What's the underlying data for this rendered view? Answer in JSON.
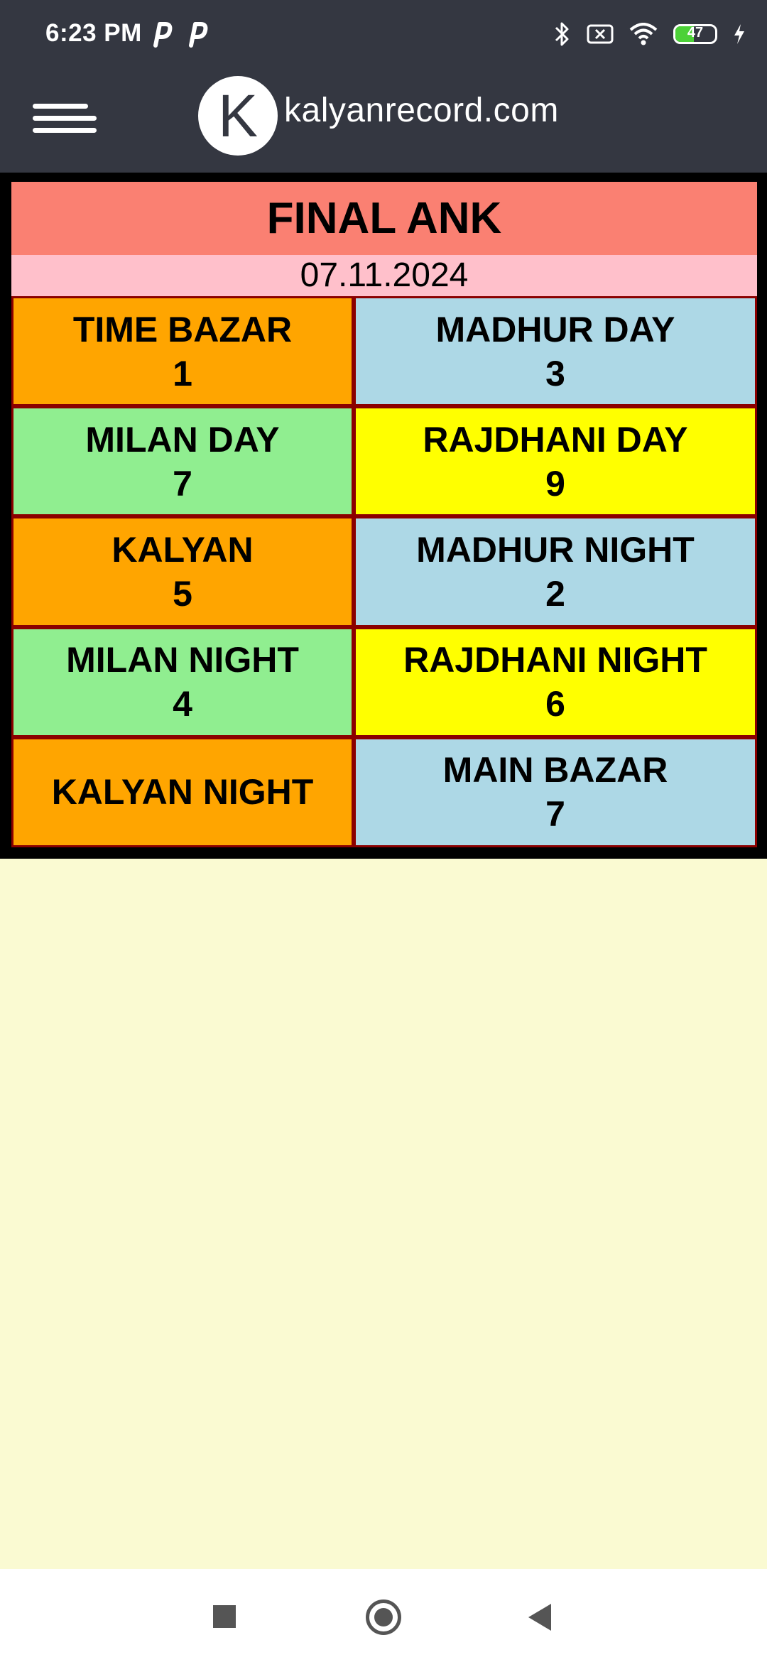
{
  "status_bar": {
    "time": "6:23 PM",
    "notification_icons": [
      "p-app-icon",
      "p-app-icon"
    ],
    "system_icons": [
      "bluetooth-icon",
      "no-sim-icon",
      "wifi-icon",
      "battery-icon",
      "charging-icon"
    ],
    "battery_level": "47"
  },
  "header": {
    "menu_icon": "hamburger-menu-icon",
    "logo_letter": "K",
    "site_title": "kalyanrecord.com"
  },
  "result": {
    "title": "FINAL ANK",
    "date": "07.11.2024",
    "markets": [
      {
        "name": "TIME BAZAR",
        "value": "1",
        "color": "#FFA500"
      },
      {
        "name": "MADHUR DAY",
        "value": "3",
        "color": "#ADD8E6"
      },
      {
        "name": "MILAN DAY",
        "value": "7",
        "color": "#90EE90"
      },
      {
        "name": "RAJDHANI DAY",
        "value": "9",
        "color": "#FFFF00"
      },
      {
        "name": "KALYAN",
        "value": "5",
        "color": "#FFA500"
      },
      {
        "name": "MADHUR NIGHT",
        "value": "2",
        "color": "#ADD8E6"
      },
      {
        "name": "MILAN NIGHT",
        "value": "4",
        "color": "#90EE90"
      },
      {
        "name": "RAJDHANI NIGHT",
        "value": "6",
        "color": "#FFFF00"
      },
      {
        "name": "KALYAN NIGHT",
        "value": "",
        "color": "#FFA500"
      },
      {
        "name": "MAIN BAZAR",
        "value": "7",
        "color": "#ADD8E6"
      }
    ]
  },
  "colors": {
    "header_bg": "#343741",
    "title_band": "#FA8072",
    "date_band": "#FFC0CB",
    "cell_border": "#8B0000",
    "page_bg": "#FAFAD2"
  },
  "nav_bar": {
    "buttons": [
      "recents-square-icon",
      "home-circle-icon",
      "back-triangle-icon"
    ]
  }
}
